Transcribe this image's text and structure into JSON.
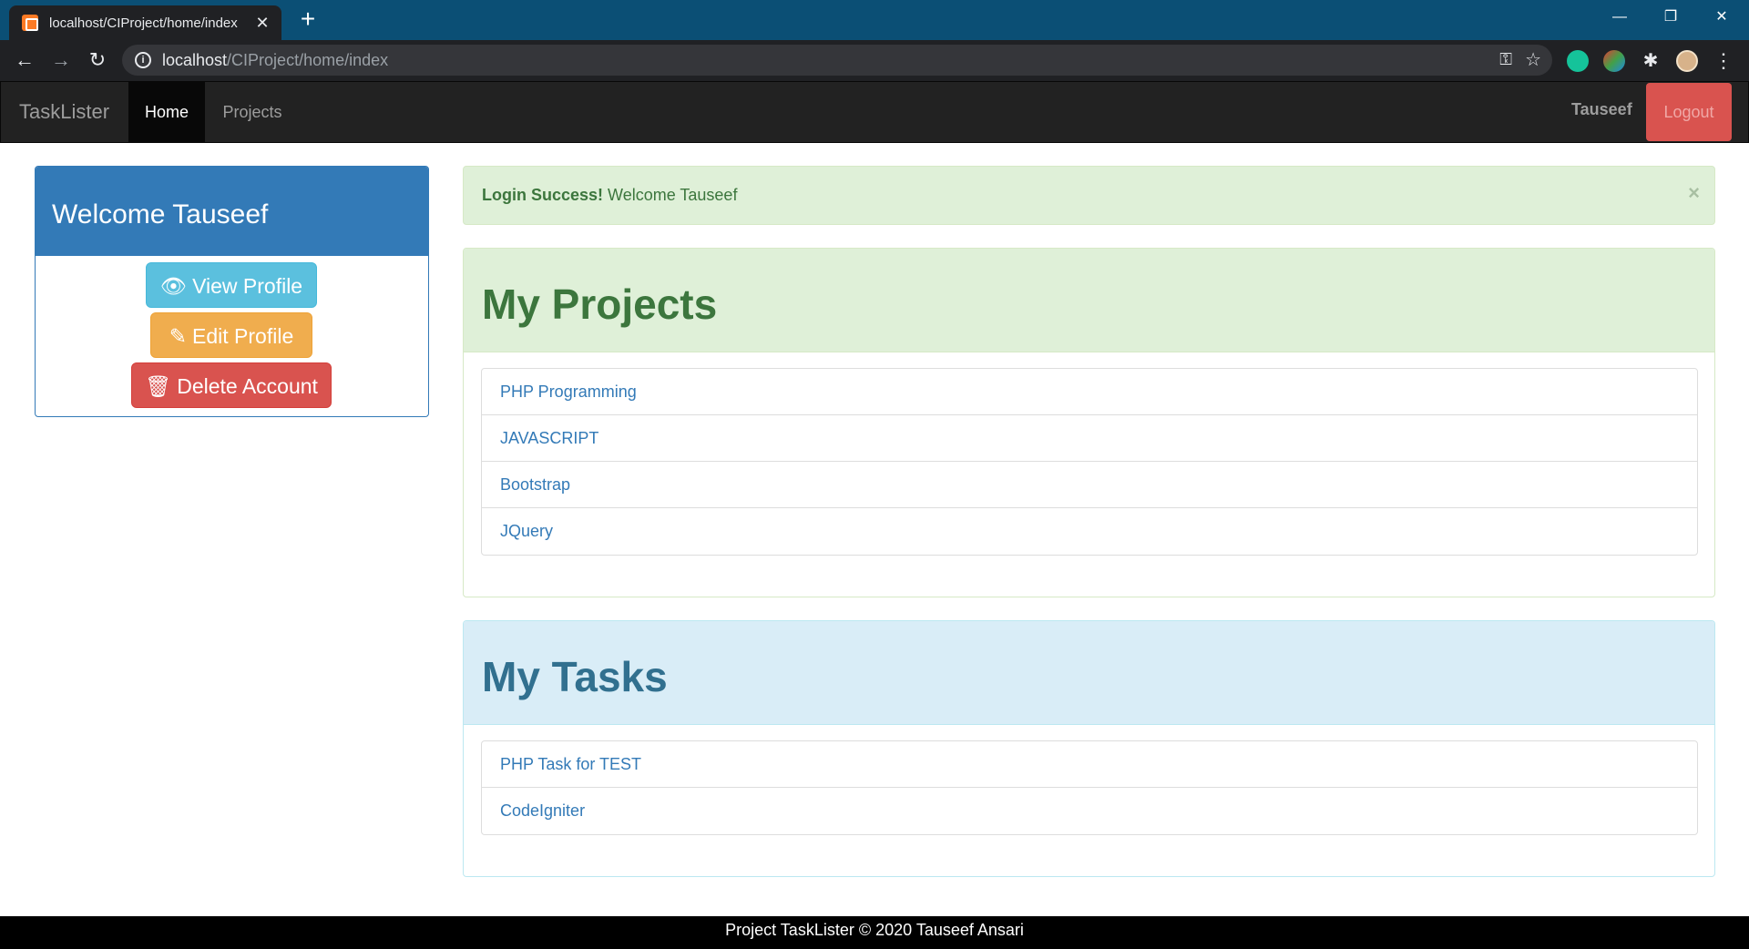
{
  "browser": {
    "tab_title": "localhost/CIProject/home/index",
    "url_host": "localhost",
    "url_path": "/CIProject/home/index"
  },
  "navbar": {
    "brand": "TaskLister",
    "items": [
      {
        "label": "Home",
        "active": true
      },
      {
        "label": "Projects",
        "active": false
      }
    ],
    "username": "Tauseef",
    "logout_label": "Logout"
  },
  "sidebar": {
    "heading": "Welcome Tauseef",
    "view_profile": "View Profile",
    "edit_profile": "Edit Profile",
    "delete_account": "Delete Account"
  },
  "alert": {
    "strong": "Login Success!",
    "message": " Welcome Tauseef",
    "close": "×"
  },
  "projects": {
    "heading": "My Projects",
    "items": [
      "PHP Programming",
      "JAVASCRIPT",
      "Bootstrap",
      "JQuery"
    ]
  },
  "tasks": {
    "heading": "My Tasks",
    "items": [
      "PHP Task for TEST",
      "CodeIgniter"
    ]
  },
  "footer": {
    "text": "Project TaskLister © 2020 Tauseef Ansari"
  },
  "colors": {
    "primary": "#337ab7",
    "info": "#5bc0de",
    "warning": "#f0ad4e",
    "danger": "#d9534f",
    "success_bg": "#dff0d8",
    "info_bg": "#d9edf7",
    "navbar_bg": "#222222"
  }
}
